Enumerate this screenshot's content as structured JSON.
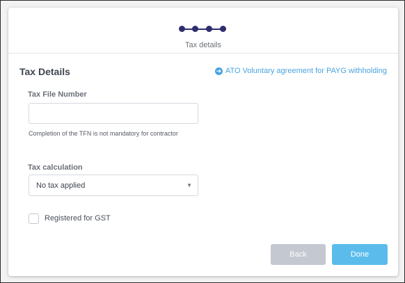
{
  "stepper": {
    "step_label": "Tax details",
    "step_count": 4,
    "active_color": "#2e2d6e"
  },
  "section": {
    "title": "Tax Details",
    "ato_link": "ATO Voluntary agreement for PAYG withholding",
    "ato_link_icon": "arrow-circle-right-icon"
  },
  "tfn": {
    "label": "Tax File Number",
    "value": "",
    "hint": "Completion of the TFN is not mandatory for contractor"
  },
  "tax_calc": {
    "label": "Tax calculation",
    "selected": "No tax applied",
    "caret": "▼"
  },
  "gst": {
    "label": "Registered for GST",
    "checked": false
  },
  "actions": {
    "back_label": "Back",
    "done_label": "Done",
    "done_color": "#5bbcec",
    "back_color": "#c3c8d1"
  }
}
